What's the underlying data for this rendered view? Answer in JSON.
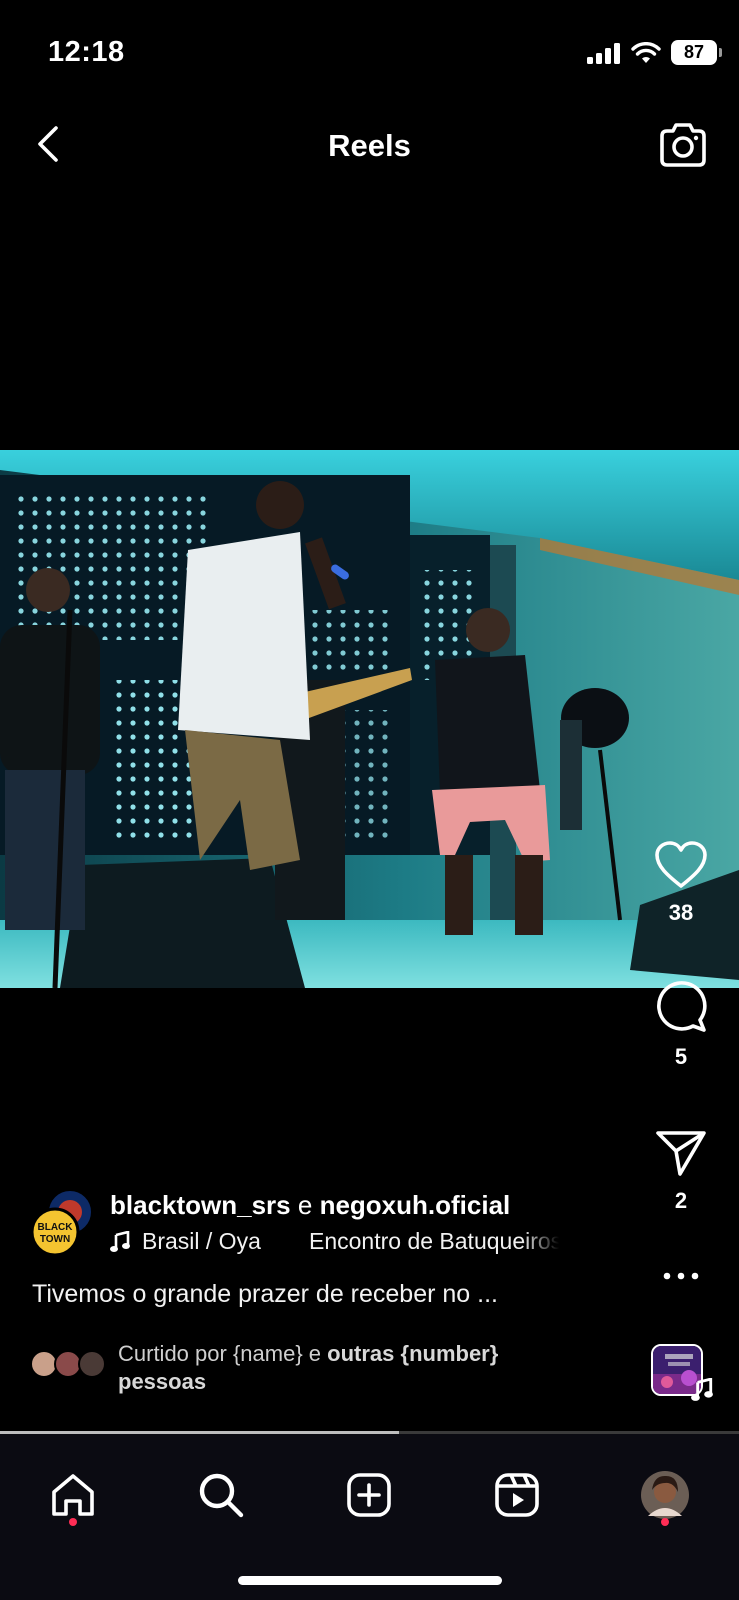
{
  "status_bar": {
    "time": "12:18",
    "battery": "87"
  },
  "header": {
    "title": "Reels"
  },
  "actions": {
    "likes": "38",
    "comments": "5",
    "shares": "2"
  },
  "author": {
    "user1": "blacktown_srs",
    "conjunction": "e",
    "user2": "negoxuh.oficial",
    "logo_text": "BLACK TOWN"
  },
  "audio": {
    "track": "Brasil / Oya",
    "album": "Encontro de Batuqueiros"
  },
  "caption": "Tivemos o grande prazer de receber no ...",
  "liked_by": {
    "prefix": "Curtido por {name} e",
    "bold": "outras {number}",
    "suffix": "pessoas"
  },
  "progress": 0.54,
  "colors": {
    "background": "#000000",
    "nav_background": "#0b0b12",
    "notification_dot": "#ff2d55",
    "stage_light": "#3fd3dc"
  },
  "icons": {
    "back": "chevron-left-icon",
    "camera": "camera-icon",
    "like": "heart-icon",
    "comment": "comment-icon",
    "share": "paper-plane-icon",
    "more": "more-icon",
    "music": "music-note-icon",
    "home": "home-icon",
    "search": "search-icon",
    "create": "plus-square-icon",
    "reels": "reels-icon",
    "profile": "profile-avatar"
  }
}
